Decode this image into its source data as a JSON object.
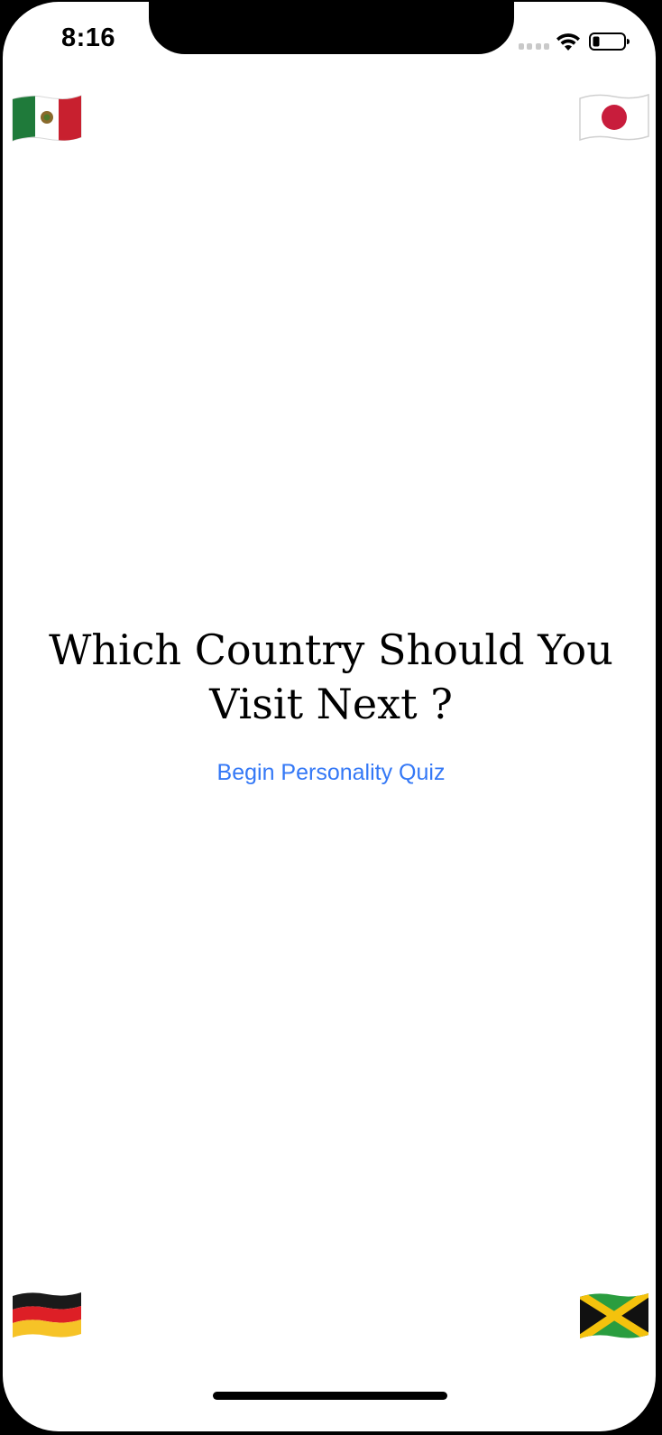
{
  "status_bar": {
    "time": "8:16",
    "icons": [
      "cellular-signal-icon",
      "wifi-icon",
      "battery-icon"
    ]
  },
  "flags": [
    {
      "name": "mexico-flag-icon",
      "position": "top-left"
    },
    {
      "name": "japan-flag-icon",
      "position": "top-right"
    },
    {
      "name": "germany-flag-icon",
      "position": "bottom-left"
    },
    {
      "name": "jamaica-flag-icon",
      "position": "bottom-right"
    }
  ],
  "main": {
    "title_line1": "Which Country Should You",
    "title_line2": "Visit Next ?",
    "begin_button_label": "Begin Personality Quiz"
  },
  "colors": {
    "accent": "#3478f6",
    "background": "#ffffff",
    "text": "#000000"
  }
}
